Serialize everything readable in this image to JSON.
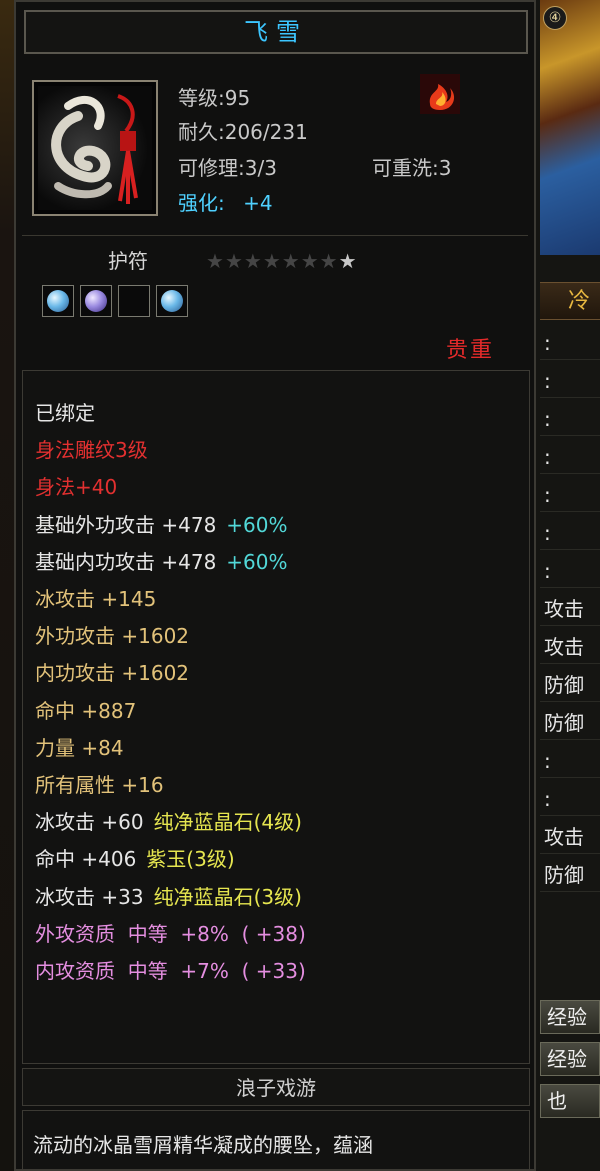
{
  "item": {
    "name": "飞雪",
    "level": "等级:95",
    "durability": "耐久:206/231",
    "repairable": "可修理:3/3",
    "rewashable": "可重洗:3",
    "enhance_label": "强化:",
    "enhance_value": "+4",
    "icon": "jade-pendant-icon",
    "element_icon": "fire-element-icon"
  },
  "amulet": {
    "label": "护符",
    "stars_total": 8,
    "stars_lit": 1,
    "slots": [
      {
        "gem": "blue"
      },
      {
        "gem": "purple"
      },
      {
        "gem": null
      },
      {
        "gem": "blue"
      }
    ]
  },
  "rarity": "贵重",
  "attributes": [
    {
      "name": "bound-status",
      "color": "white",
      "parts": [
        "已绑定"
      ]
    },
    {
      "name": "engraving",
      "color": "red",
      "parts": [
        "身法雕纹3级"
      ]
    },
    {
      "name": "agility-bonus",
      "color": "red",
      "parts": [
        "身法+40"
      ]
    },
    {
      "name": "base-ext-attack",
      "color": "white",
      "parts": [
        "基础外功攻击 +478"
      ],
      "extra": "+60%",
      "extra_color": "cyan"
    },
    {
      "name": "base-int-attack",
      "color": "white",
      "parts": [
        "基础内功攻击 +478"
      ],
      "extra": "+60%",
      "extra_color": "cyan"
    },
    {
      "name": "ice-attack",
      "color": "gold",
      "parts": [
        "冰攻击 +145"
      ]
    },
    {
      "name": "ext-attack",
      "color": "gold",
      "parts": [
        "外功攻击 +1602"
      ]
    },
    {
      "name": "int-attack",
      "color": "gold",
      "parts": [
        "内功攻击 +1602"
      ]
    },
    {
      "name": "hit",
      "color": "gold",
      "parts": [
        "命中 +887"
      ]
    },
    {
      "name": "strength",
      "color": "gold",
      "parts": [
        "力量 +84"
      ]
    },
    {
      "name": "all-attributes",
      "color": "gold",
      "parts": [
        "所有属性 +16"
      ]
    },
    {
      "name": "gem-ice-attack-1",
      "color": "white",
      "parts": [
        "冰攻击 +60"
      ],
      "extra": "纯净蓝晶石(4级)",
      "extra_color": "yellow"
    },
    {
      "name": "gem-hit",
      "color": "white",
      "parts": [
        "命中 +406"
      ],
      "extra": "紫玉(3级)",
      "extra_color": "yellow"
    },
    {
      "name": "gem-ice-attack-2",
      "color": "white",
      "parts": [
        "冰攻击 +33"
      ],
      "extra": "纯净蓝晶石(3级)",
      "extra_color": "yellow"
    },
    {
      "name": "ext-aptitude",
      "color": "pink",
      "parts": [
        "外攻资质  中等  +8%  ( +38)"
      ]
    },
    {
      "name": "int-aptitude",
      "color": "pink",
      "parts": [
        "内攻资质  中等  +7%  ( +33)"
      ]
    }
  ],
  "set_name": "浪子戏游",
  "description": "流动的冰晶雪屑精华凝成的腰坠，蕴涵",
  "background": {
    "badge": "④",
    "tab_label": "冷",
    "rows": [
      ":",
      ":",
      ":",
      ":",
      ":",
      ":",
      ":",
      "攻击",
      "攻击",
      "防御",
      "防御",
      ":",
      ":",
      "攻击",
      "防御"
    ],
    "buttons": [
      "经验",
      "经验",
      "也"
    ]
  }
}
